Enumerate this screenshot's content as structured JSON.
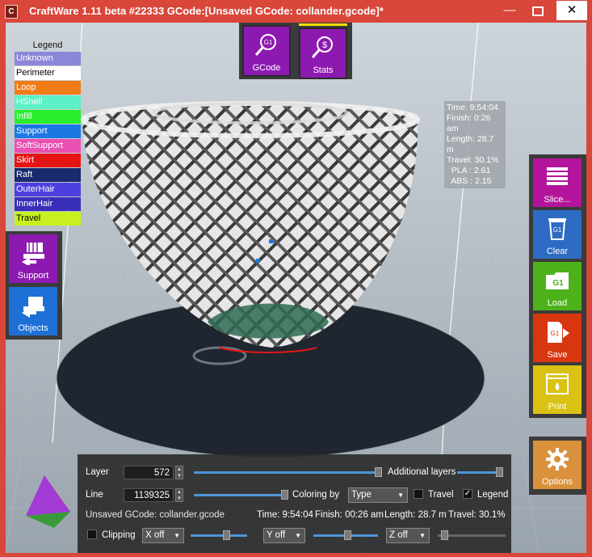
{
  "window": {
    "title": "CraftWare 1.11 beta #22333   GCode:[Unsaved GCode: collander.gcode]*",
    "app_icon": "C",
    "controls": [
      "minimize-icon",
      "maximize-icon",
      "close-icon"
    ]
  },
  "top_buttons": {
    "gcode": {
      "label": "GCode",
      "icon_text": "G1",
      "icon": "magnifier-icon"
    },
    "stats": {
      "label": "Stats",
      "icon_text": "$",
      "icon": "magnifier-icon"
    }
  },
  "legend": {
    "title": "Legend",
    "items": [
      {
        "label": "Unknown",
        "color": "#8c86d8"
      },
      {
        "label": "Perimeter",
        "color": "#ffffff",
        "text_color": "#000000"
      },
      {
        "label": "Loop",
        "color": "#f07c17"
      },
      {
        "label": "HShell",
        "color": "#5ef0c7"
      },
      {
        "label": "Infill",
        "color": "#28ee2e"
      },
      {
        "label": "Support",
        "color": "#1b78e3"
      },
      {
        "label": "SoftSupport",
        "color": "#ea4fb2"
      },
      {
        "label": "Skirt",
        "color": "#e61515"
      },
      {
        "label": "Raft",
        "color": "#1a2a6c"
      },
      {
        "label": "OuterHair",
        "color": "#4d3fe0"
      },
      {
        "label": "InnerHair",
        "color": "#3a2fb8"
      },
      {
        "label": "Travel",
        "color": "#c7f01e",
        "text_color": "#000000"
      }
    ]
  },
  "stats_overlay": {
    "lines": [
      "Time: 9:54:04",
      "Finish: 0:26 am",
      "Length: 28.7 m",
      "Travel: 30.1%",
      "  PLA : 2.61",
      "  ABS : 2.15"
    ]
  },
  "left_buttons": {
    "support": {
      "label": "Support",
      "icon": "support-icon",
      "color": "#8d1ab0"
    },
    "objects": {
      "label": "Objects",
      "icon": "objects-icon",
      "color": "#1e6fd6"
    }
  },
  "right_buttons": {
    "slice": {
      "label": "Slice...",
      "icon": "slice-icon",
      "color": "#b3149b"
    },
    "clear": {
      "label": "Clear",
      "icon": "trash-icon",
      "icon_text": "G1",
      "color": "#2e6cc4"
    },
    "load": {
      "label": "Load",
      "icon": "folder-icon",
      "icon_text": "G1",
      "color": "#4db21a"
    },
    "save": {
      "label": "Save",
      "icon": "save-icon",
      "icon_text": "G1",
      "color": "#d8360e"
    },
    "print": {
      "label": "Print",
      "icon": "print-icon",
      "color": "#d9c214"
    },
    "options": {
      "label": "Options",
      "icon": "gear-icon",
      "color": "#d9913c"
    }
  },
  "bottom_panel": {
    "layer_label": "Layer",
    "layer_value": "572",
    "layer_slider": 1.0,
    "additional_layers_label": "Additional layers",
    "line_label": "Line",
    "line_value": "1139325",
    "line_slider": 1.0,
    "coloring_by_label": "Coloring by",
    "coloring_value": "Type",
    "travel_label": "Travel",
    "travel_checked": false,
    "legend_label": "Legend",
    "legend_checked": true,
    "status_file": "Unsaved GCode: collander.gcode",
    "status_time": "Time: 9:54:04",
    "status_finish": "Finish: 00:26 am",
    "status_length": "Length: 28.7 m",
    "status_travel": "Travel: 30.1%",
    "clipping_label": "Clipping",
    "clipping_checked": false,
    "x_clip": "X off",
    "y_clip": "Y off",
    "z_clip": "Z off"
  }
}
